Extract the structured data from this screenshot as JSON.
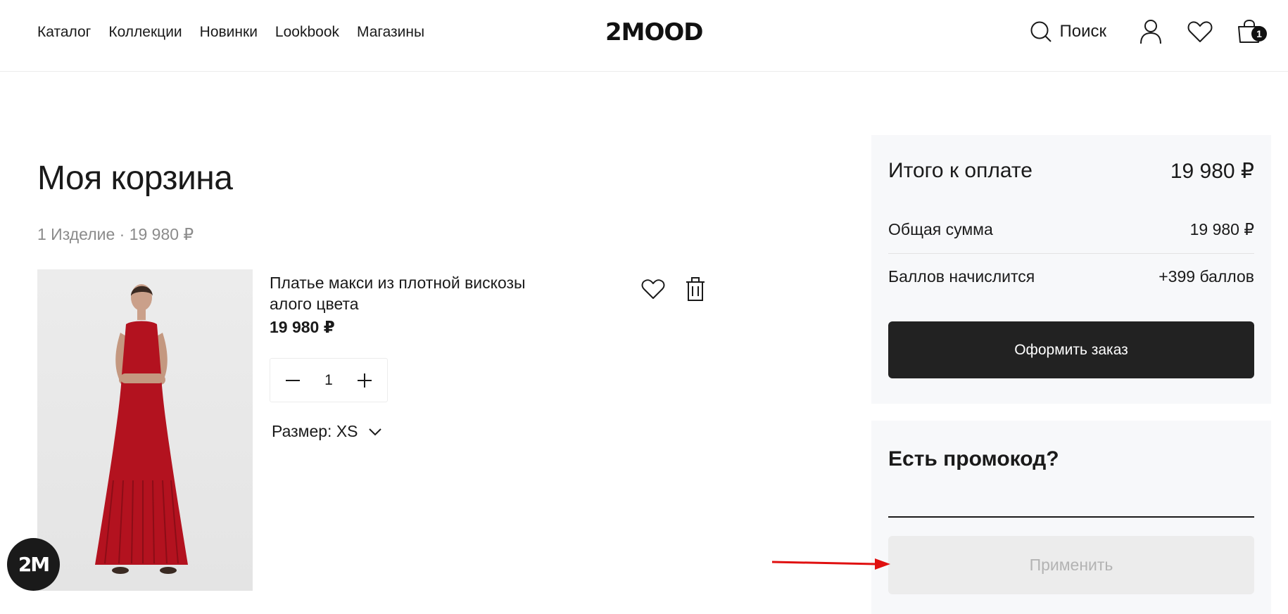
{
  "header": {
    "nav": [
      "Каталог",
      "Коллекции",
      "Новинки",
      "Lookbook",
      "Магазины"
    ],
    "logo": "2MOOD",
    "search_label": "Поиск",
    "cart_count": "1",
    "icons": [
      "search-icon",
      "user-icon",
      "heart-icon",
      "cart-icon"
    ]
  },
  "cart": {
    "title": "Моя корзина",
    "subtitle": "1 Изделие · 19 980 ₽",
    "item": {
      "name": "Платье макси из плотной вискозы алого цвета",
      "price": "19 980 ₽",
      "quantity": "1",
      "size_label": "Размер: XS",
      "dress_color": "#b3121f"
    }
  },
  "summary": {
    "total_label": "Итого к оплате",
    "total_value": "19 980 ₽",
    "subtotal_label": "Общая сумма",
    "subtotal_value": "19 980 ₽",
    "points_label": "Баллов начислится",
    "points_value": "+399 баллов",
    "checkout_label": "Оформить заказ"
  },
  "promo": {
    "title": "Есть промокод?",
    "input_value": "",
    "apply_label": "Применить"
  },
  "fab": {
    "label": "2M"
  },
  "colors": {
    "dark": "#222222",
    "panel_bg": "#f7f8fa",
    "muted": "#8b8b8b",
    "annotation_arrow": "#e01010"
  }
}
